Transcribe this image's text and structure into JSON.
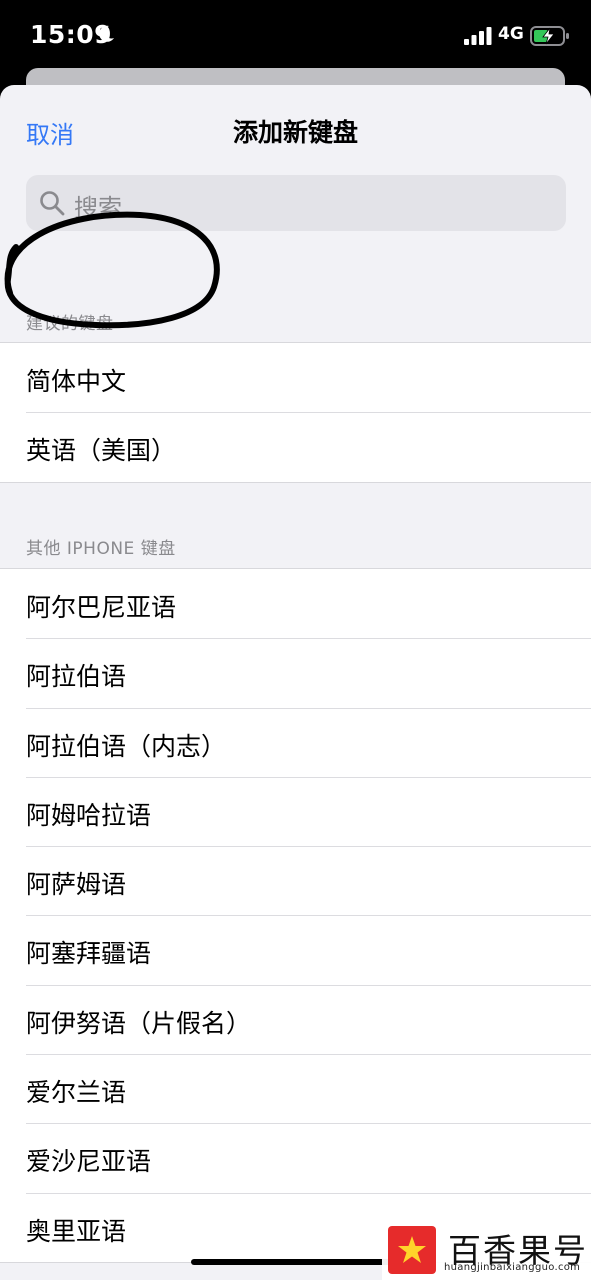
{
  "status_bar": {
    "time": "15:09",
    "network": "4G",
    "icons": [
      "moon-icon",
      "signal-icon",
      "battery-charging-icon"
    ]
  },
  "nav": {
    "cancel_label": "取消",
    "title": "添加新键盘"
  },
  "search": {
    "placeholder": "搜索",
    "icon": "search-icon"
  },
  "suggested": {
    "header": "建议的键盘",
    "items": [
      "简体中文",
      "英语（美国）"
    ]
  },
  "other": {
    "header": "其他 IPHONE 键盘",
    "items": [
      "阿尔巴尼亚语",
      "阿拉伯语",
      "阿拉伯语（内志）",
      "阿姆哈拉语",
      "阿萨姆语",
      "阿塞拜疆语",
      "阿伊努语（片假名）",
      "爱尔兰语",
      "爱沙尼亚语",
      "奥里亚语"
    ]
  },
  "watermark": {
    "brand": "百香果号",
    "url": "huangjinbaixiangguo.com"
  },
  "colors": {
    "accent": "#3478f6",
    "background": "#f2f2f6",
    "secondary_text": "#8a8a8e",
    "watermark_red": "#e62b2b"
  }
}
